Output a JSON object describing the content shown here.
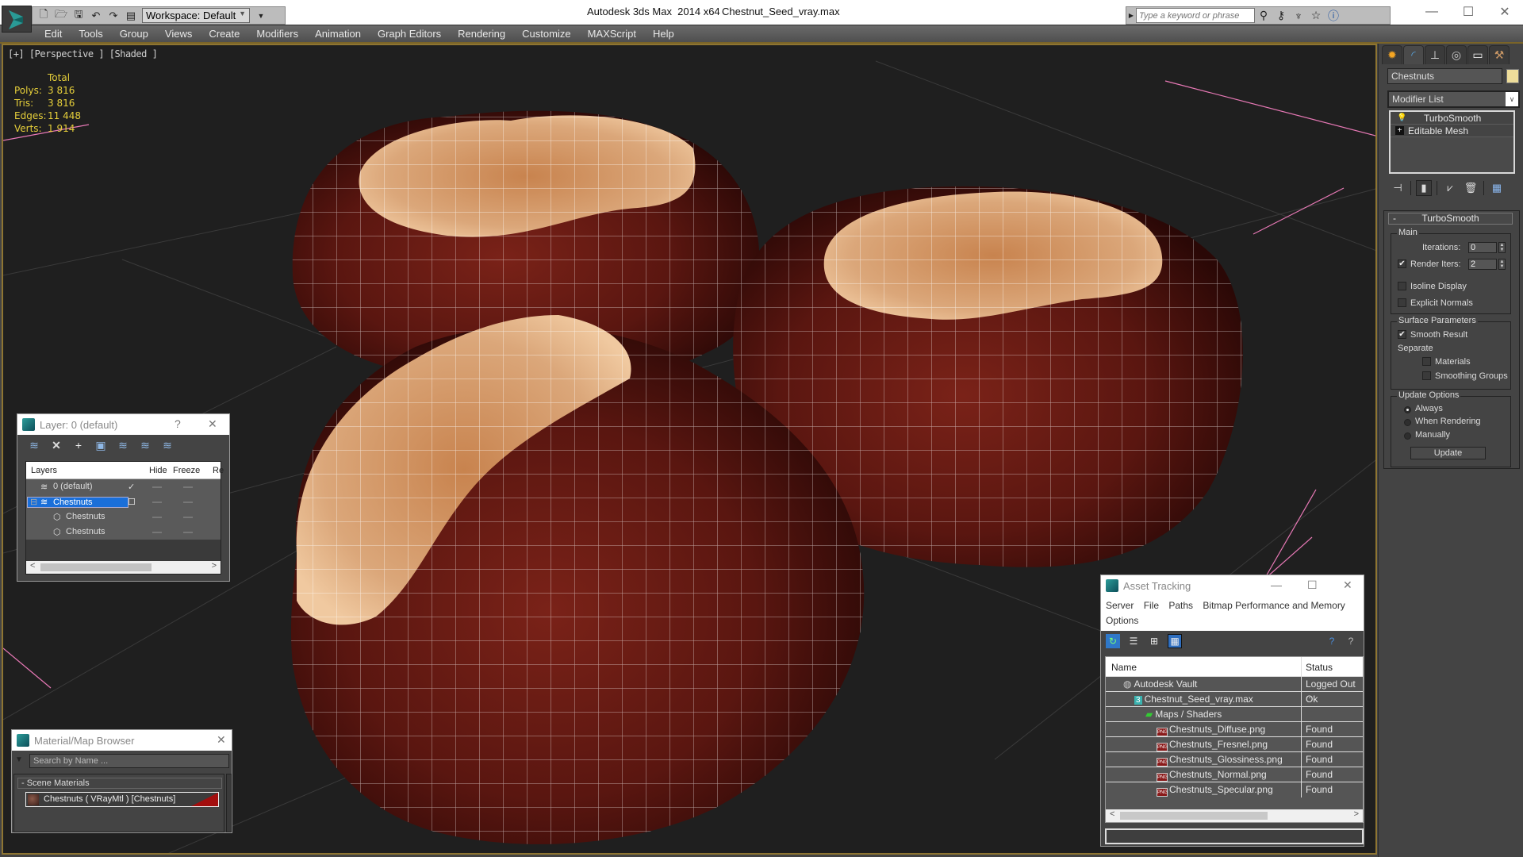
{
  "titlebar": {
    "app_title": "Autodesk 3ds Max  2014 x64",
    "file_name": "Chestnut_Seed_vray.max",
    "workspace": "Workspace: Default",
    "search_placeholder": "Type a keyword or phrase",
    "search_tools": [
      "binoculars-icon",
      "key-icon",
      "satellite-icon",
      "star-icon",
      "help-icon"
    ],
    "window_controls": {
      "minimize": "—",
      "maximize": "☐",
      "close": "✕"
    }
  },
  "menu": [
    "Edit",
    "Tools",
    "Group",
    "Views",
    "Create",
    "Modifiers",
    "Animation",
    "Graph Editors",
    "Rendering",
    "Customize",
    "MAXScript",
    "Help"
  ],
  "viewport": {
    "label": "[+] [Perspective ] [Shaded ]",
    "stats": {
      "header": "Total",
      "rows": [
        {
          "key": "Polys:",
          "value": "3 816"
        },
        {
          "key": "Tris:",
          "value": "3 816"
        },
        {
          "key": "Edges:",
          "value": "11 448"
        },
        {
          "key": "Verts:",
          "value": "1 914"
        }
      ]
    }
  },
  "command_panel": {
    "tabs": [
      "create-tab",
      "modify-tab",
      "hierarchy-tab",
      "motion-tab",
      "display-tab",
      "utilities-tab"
    ],
    "active_tab": "modify-tab",
    "object_name": "Chestnuts",
    "object_color": "#eedd9a",
    "modifier_list": "Modifier List",
    "stack": [
      "TurboSmooth",
      "Editable Mesh"
    ],
    "turbosmooth": {
      "title": "TurboSmooth",
      "main_group": "Main",
      "iterations_label": "Iterations:",
      "iterations": "0",
      "render_iters_label": "Render Iters:",
      "render_iters": "2",
      "render_iters_checked": true,
      "isoline_label": "Isoline Display",
      "isoline_checked": false,
      "explicit_label": "Explicit Normals",
      "explicit_checked": false,
      "surface_group": "Surface Parameters",
      "smooth_result_label": "Smooth Result",
      "smooth_result_checked": true,
      "separate_label": "Separate",
      "materials_label": "Materials",
      "smoothing_groups_label": "Smoothing Groups",
      "update_group": "Update Options",
      "update_options": [
        "Always",
        "When Rendering",
        "Manually"
      ],
      "update_selected": "Always",
      "update_button": "Update"
    }
  },
  "layer_window": {
    "title": "Layer: 0 (default)",
    "help": "?",
    "close": "✕",
    "columns": [
      "Layers",
      "",
      "Hide",
      "Freeze",
      "Re"
    ],
    "rows": [
      {
        "name": "0 (default)",
        "current": "✓"
      },
      {
        "name": "Chestnuts",
        "current": "☐",
        "selected": true
      },
      {
        "name": "Chestnuts"
      },
      {
        "name": "Chestnuts"
      }
    ]
  },
  "material_browser": {
    "title": "Material/Map Browser",
    "close": "✕",
    "search_placeholder": "Search by Name ...",
    "group": "- Scene Materials",
    "item": "Chestnuts  ( VRayMtl ) [Chestnuts]"
  },
  "asset_tracking": {
    "title": "Asset Tracking",
    "menu": [
      "Server",
      "File",
      "Paths",
      "Bitmap Performance and Memory",
      "Options"
    ],
    "columns": [
      "Name",
      "Status"
    ],
    "rows": [
      {
        "name": "Autodesk Vault",
        "status": "Logged Out ..",
        "indent": 1,
        "icon": "vault-icon"
      },
      {
        "name": "Chestnut_Seed_vray.max",
        "status": "Ok",
        "indent": 2,
        "icon": "max-file-icon"
      },
      {
        "name": "Maps / Shaders",
        "status": "",
        "indent": 3,
        "icon": "maps-icon"
      },
      {
        "name": "Chestnuts_Diffuse.png",
        "status": "Found",
        "indent": 4,
        "icon": "png-icon"
      },
      {
        "name": "Chestnuts_Fresnel.png",
        "status": "Found",
        "indent": 4,
        "icon": "png-icon"
      },
      {
        "name": "Chestnuts_Glossiness.png",
        "status": "Found",
        "indent": 4,
        "icon": "png-icon"
      },
      {
        "name": "Chestnuts_Normal.png",
        "status": "Found",
        "indent": 4,
        "icon": "png-icon"
      },
      {
        "name": "Chestnuts_Specular.png",
        "status": "Found",
        "indent": 4,
        "icon": "png-icon"
      }
    ]
  }
}
